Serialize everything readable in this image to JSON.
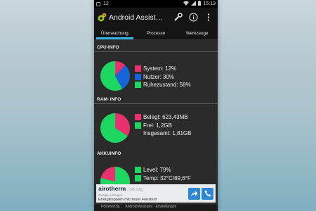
{
  "statusbar": {
    "notification_count": "12",
    "time": "15:19"
  },
  "app": {
    "title": "Android Assist…"
  },
  "tabs": [
    {
      "label": "Überwachung",
      "active": true
    },
    {
      "label": "Prozesse",
      "active": false
    },
    {
      "label": "Werkzeuge",
      "active": false
    }
  ],
  "cpu": {
    "header": "CPU-INFO",
    "items": [
      {
        "label": "System: 12%",
        "color": "#e8316f",
        "percent": 12
      },
      {
        "label": "Nutzer: 30%",
        "color": "#1565d8",
        "percent": 30
      },
      {
        "label": "Ruhezustand: 58%",
        "color": "#1ed760",
        "percent": 58
      }
    ]
  },
  "ram": {
    "header": "RAM- INFO",
    "items": [
      {
        "label": "Belegt: 623,43MB",
        "color": "#e8316f",
        "percent": 34
      },
      {
        "label": "Frei: 1,2GB",
        "color": "#1ed760",
        "percent": 66
      }
    ],
    "total": "Insgesamt: 1,81GB"
  },
  "akku": {
    "header": "AKKUINFO",
    "items": [
      {
        "label": "Level: 79%",
        "color": "#1ed760",
        "percent": 79
      },
      {
        "label": "Temp: 32°C/89,6°F",
        "color": "#1ed760"
      }
    ]
  },
  "ad": {
    "brand": "airotherm",
    "brand_suffix": "...om.org",
    "sub": "Google Anzeigen",
    "line": "Energiesparen mit neuer Fenstern"
  },
  "footer": {
    "text": "Powered by... · Android Assistant · Einstellungen"
  }
}
